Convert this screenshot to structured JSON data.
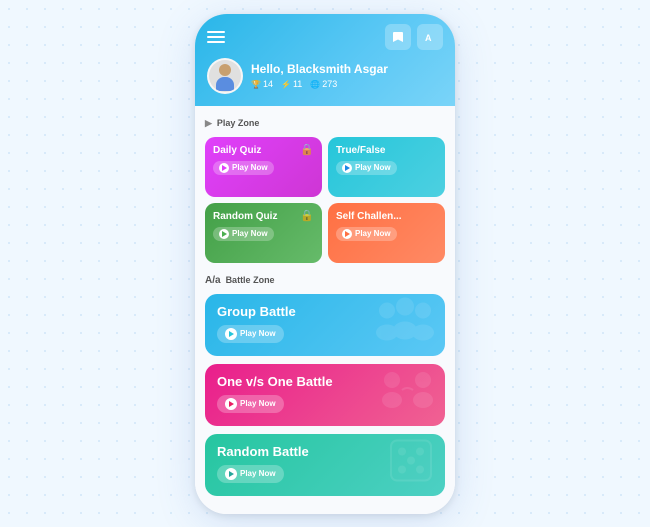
{
  "header": {
    "greeting": "Hello, Blacksmith Asgar",
    "stats": [
      {
        "icon": "🏆",
        "value": "14"
      },
      {
        "icon": "⚡",
        "value": "11"
      },
      {
        "icon": "🌐",
        "value": "273"
      }
    ],
    "icons": [
      "bookmark",
      "translate"
    ]
  },
  "play_zone": {
    "label": "Play Zone",
    "cards": [
      {
        "id": "daily-quiz",
        "title": "Daily Quiz",
        "style": "daily",
        "locked": true,
        "play_label": "Play Now"
      },
      {
        "id": "true-false",
        "title": "True/False",
        "style": "truefalse",
        "locked": false,
        "play_label": "Play Now"
      },
      {
        "id": "random-quiz",
        "title": "Random Quiz",
        "style": "random",
        "locked": true,
        "play_label": "Play Now"
      },
      {
        "id": "self-challenge",
        "title": "Self Challen...",
        "style": "selfchallenge",
        "locked": false,
        "play_label": "Play Now"
      }
    ]
  },
  "battle_zone": {
    "label": "Battle Zone",
    "battles": [
      {
        "id": "group-battle",
        "title": "Group Battle",
        "style": "group",
        "play_label": "Play Now",
        "illustration": "👥"
      },
      {
        "id": "one-vs-one",
        "title": "One v/s One Battle",
        "style": "onevone",
        "play_label": "Play Now",
        "illustration": "🤝"
      },
      {
        "id": "random-battle",
        "title": "Random Battle",
        "style": "random-battle",
        "play_label": "Play Now",
        "illustration": "🎲"
      }
    ]
  }
}
